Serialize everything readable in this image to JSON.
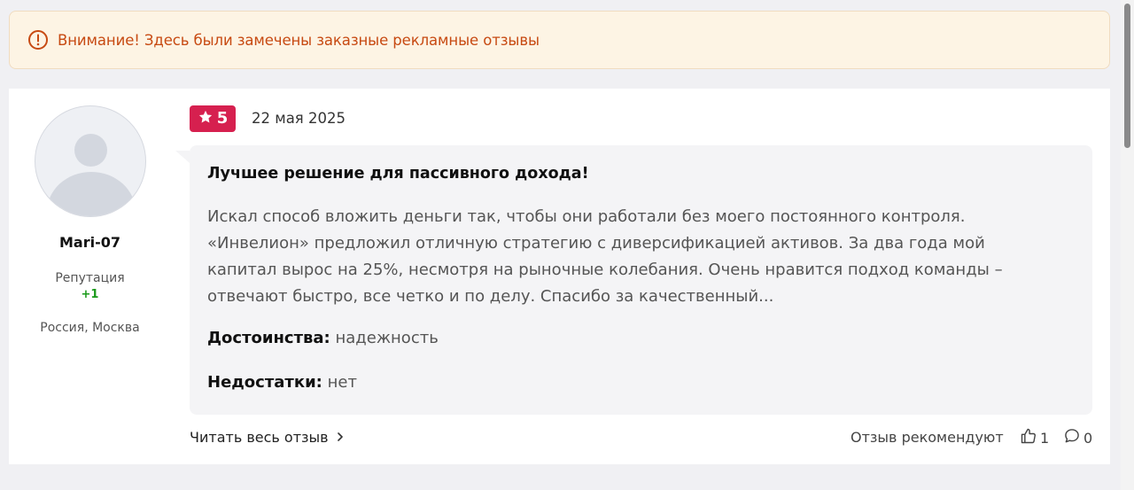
{
  "warning": {
    "icon": "alert-circle-icon",
    "text": "Внимание! Здесь были замечены заказные рекламные отзывы",
    "color": "#c74a12",
    "background": "#fdf4e4"
  },
  "author": {
    "name": "Mari-07",
    "reputation_label": "Репутация",
    "reputation_value": "+1",
    "location": "Россия, Москва"
  },
  "review": {
    "rating": "5",
    "rating_color": "#d6204f",
    "date": "22 мая 2025",
    "title": "Лучшее решение для пассивного дохода!",
    "body": "Искал способ вложить деньги так, чтобы они работали без моего постоянного контроля. «Инвелион» предложил отличную стратегию с диверсификацией активов. За два года мой капитал вырос на 25%, несмотря на рыночные колебания. Очень нравится подход команды – отвечают быстро, все четко и по делу. Спасибо за качественный...",
    "pros_label": "Достоинства:",
    "pros_value": "надежность",
    "cons_label": "Недостатки:",
    "cons_value": "нет"
  },
  "footer": {
    "read_more": "Читать весь отзыв",
    "recommend_label": "Отзыв рекомендуют",
    "likes": "1",
    "comments": "0"
  }
}
